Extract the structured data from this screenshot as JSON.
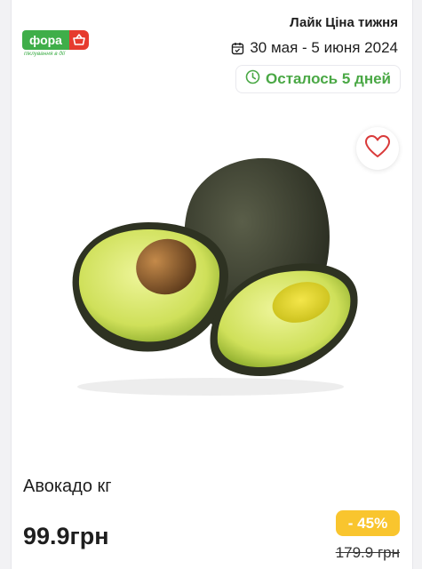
{
  "brand": {
    "name": "фора",
    "tagline": "піклування в дії",
    "colors": {
      "green": "#3fae49",
      "red": "#e63b2e"
    }
  },
  "promo": {
    "title": "Лайк Ціна тижня",
    "date_range": "30 мая - 5 июня 2024",
    "remaining": "Осталось 5 дней"
  },
  "product": {
    "name": "Авокадо кг",
    "price": "99.9грн",
    "discount": "- 45%",
    "old_price": "179.9 грн",
    "image": "avocado-image"
  },
  "icons": {
    "calendar": "calendar-icon",
    "clock": "clock-icon",
    "favorite": "heart-icon",
    "basket": "basket-icon"
  },
  "colors": {
    "accent_green": "#4aa845",
    "discount_badge": "#f9c52e",
    "heart": "#d93a3a"
  }
}
